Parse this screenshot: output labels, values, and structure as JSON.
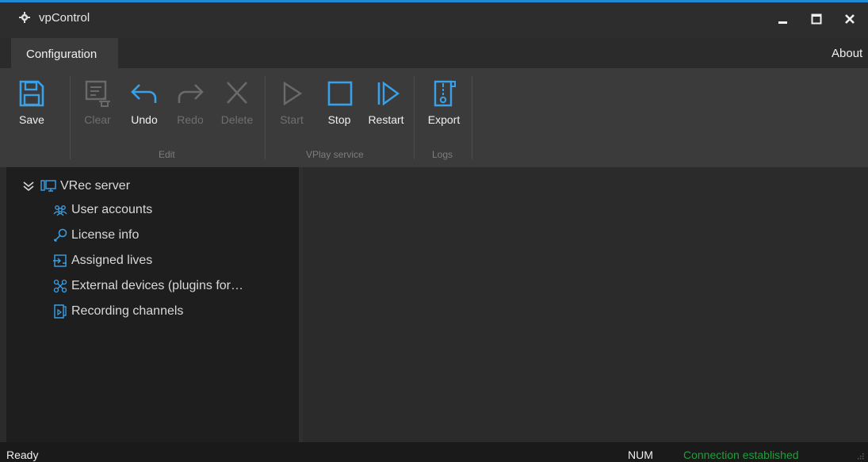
{
  "window": {
    "title": "vpControl",
    "app_icon": "gear-icon",
    "controls": [
      "minimize-icon",
      "maximize-icon",
      "close-icon"
    ]
  },
  "tabs": [
    {
      "label": "Configuration",
      "selected": true
    }
  ],
  "about_label": "About",
  "ribbon": {
    "groups": [
      {
        "label": "",
        "buttons": [
          {
            "label": "Save",
            "icon": "save-icon",
            "enabled": true
          }
        ]
      },
      {
        "label": "Edit",
        "buttons": [
          {
            "label": "Clear",
            "icon": "clear-icon",
            "enabled": false
          },
          {
            "label": "Undo",
            "icon": "undo-icon",
            "enabled": true
          },
          {
            "label": "Redo",
            "icon": "redo-icon",
            "enabled": false
          },
          {
            "label": "Delete",
            "icon": "delete-icon",
            "enabled": false
          }
        ]
      },
      {
        "label": "VPlay service",
        "buttons": [
          {
            "label": "Start",
            "icon": "play-icon",
            "enabled": false
          },
          {
            "label": "Stop",
            "icon": "stop-icon",
            "enabled": true
          },
          {
            "label": "Restart",
            "icon": "restart-icon",
            "enabled": true
          }
        ]
      },
      {
        "label": "Logs",
        "buttons": [
          {
            "label": "Export",
            "icon": "export-icon",
            "enabled": true
          }
        ]
      }
    ]
  },
  "tree": {
    "root": {
      "label": "VRec server",
      "expanded": true,
      "icon": "monitor-icon"
    },
    "children": [
      {
        "label": "User accounts",
        "icon": "users-icon"
      },
      {
        "label": "License info",
        "icon": "key-icon"
      },
      {
        "label": "Assigned lives",
        "icon": "assign-icon"
      },
      {
        "label": "External devices (plugins for…",
        "icon": "plugin-icon"
      },
      {
        "label": "Recording channels",
        "icon": "recording-icon"
      }
    ]
  },
  "status": {
    "ready": "Ready",
    "num": "NUM",
    "connection": "Connection established"
  },
  "colors": {
    "accent": "#1f8ad6",
    "icon_blue": "#3aa0e8",
    "connection_green": "#1f9f3a"
  }
}
